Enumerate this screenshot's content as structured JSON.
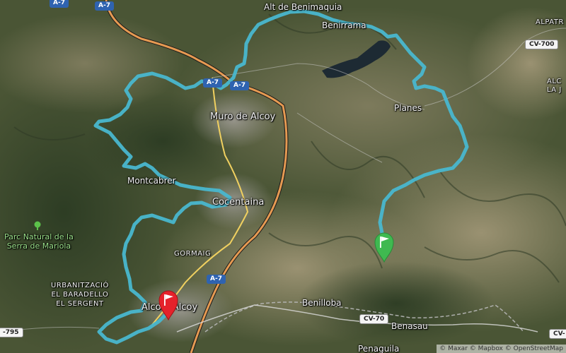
{
  "map": {
    "places": {
      "alt_de_benimaquia": "Alt de Benimaquia",
      "benirrama": "Benirrama",
      "alpatro": "ALPATR",
      "alcala": "ALC\nLA J",
      "muro_de_alcoy": "Muro de Alcoy",
      "planes": "Planes",
      "montcabrer": "Montcabrer",
      "cocentaina": "Cocentaina",
      "parc_natural": "Parc Natural de la\nSerra de Mariola",
      "gormaig": "GORMAIG",
      "urbanitzacio": "URBANITZACIÓ\nEL BARADELLO\nEL SERGENT",
      "alcoi": "Alcoi / Alcoy",
      "benilloba": "Benilloba",
      "benasau": "Benasau",
      "penaguila": "Penaguila"
    },
    "roads": {
      "a7_top1": "A-7",
      "a7_top2": "A-7",
      "a7_mid": "A-7",
      "a7_center": "A-7",
      "a7_south": "A-7",
      "cv700": "CV-700",
      "cv70": "CV-70",
      "cv795": "-795",
      "cv_br": "CV-"
    },
    "attribution": "© Maxar © Mapbox © OpenStreetMap",
    "colors": {
      "route": "#49b7cf",
      "start_marker": "#3fb950",
      "finish_marker": "#e5222b",
      "highway": "#e59a52",
      "secondary_road": "#f0d060",
      "reservoir": "#1d2a33"
    },
    "markers": {
      "start": "flag-icon",
      "finish": "flag-icon"
    }
  }
}
